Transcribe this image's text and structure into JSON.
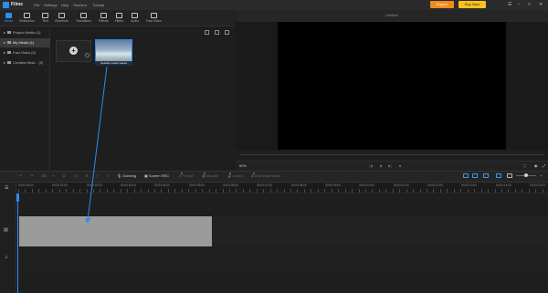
{
  "app": {
    "name": "Filme"
  },
  "menu": [
    "File",
    "Settings",
    "Help",
    "Shortcut",
    "Tutorial"
  ],
  "title_buttons": {
    "export": "Export",
    "buy_now": "Buy Now"
  },
  "media_tools": [
    {
      "label": "Media",
      "active": true
    },
    {
      "label": "Resources",
      "active": false
    },
    {
      "label": "Text",
      "active": false
    },
    {
      "label": "Elements",
      "active": false
    },
    {
      "label": "Transitions",
      "active": false
    },
    {
      "label": "Effects",
      "active": false
    },
    {
      "label": "Filters",
      "active": false
    },
    {
      "label": "Audio",
      "active": false
    },
    {
      "label": "Fast Video",
      "active": false
    }
  ],
  "sidebar": {
    "items": [
      {
        "label": "Project Media (1)",
        "selected": false
      },
      {
        "label": "My Media (1)",
        "selected": true
      },
      {
        "label": "Fast Video (0)",
        "selected": false
      },
      {
        "label": "Created Medi... (0)",
        "selected": false
      }
    ]
  },
  "media": {
    "thumb_label": "Seaside ocean waves"
  },
  "preview": {
    "title": "Untitled",
    "zoom": "50%"
  },
  "timeline_tools": {
    "dubbing": "Dubbing",
    "screen_rec": "Screen REC",
    "freeze": "Freeze",
    "mosaic": "Mosaic",
    "cutout": "Cutout",
    "add_watermark": "Add Watermark"
  },
  "ruler": [
    "00:00:00:00",
    "00:00:01:00",
    "00:00:02:00",
    "00:00:03:00",
    "00:00:04:00",
    "00:00:05:00",
    "00:00:06:00",
    "00:00:07:00",
    "00:00:08:00",
    "00:00:09:00",
    "00:00:10:00",
    "00:00:11:00",
    "00:00:12:00",
    "00:00:13:00",
    "00:00:14:00",
    "00:00:15:00"
  ],
  "colors": {
    "accent": "#2d8cf0",
    "export": "#f08c1e",
    "buy_now": "#f6c21b",
    "clip": "#9b9b9b"
  },
  "icons": {
    "preview_transport": [
      "skip-back-icon",
      "play-icon",
      "skip-forward-icon",
      "stop-icon"
    ],
    "track_video": "video-track-icon",
    "track_audio": "music-note-icon"
  }
}
